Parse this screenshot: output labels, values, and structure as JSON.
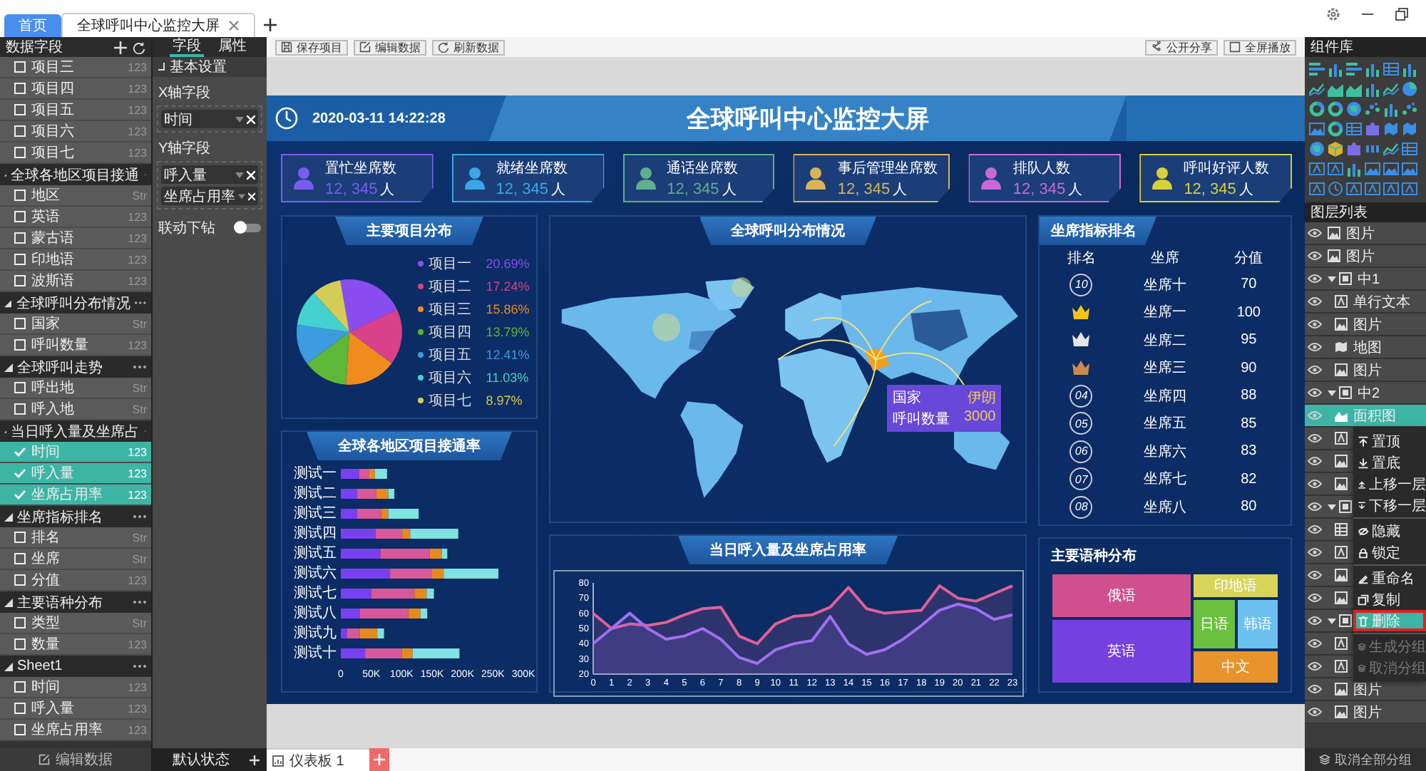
{
  "top_tabs": [
    {
      "label": "首页",
      "selected": false
    },
    {
      "label": "全球呼叫中心监控大屏",
      "selected": true
    }
  ],
  "fields_panel": {
    "title": "数据字段",
    "footer": "编辑数据",
    "groups": [
      {
        "fields": [
          {
            "label": "项目三",
            "type": "123",
            "checked": false
          },
          {
            "label": "项目四",
            "type": "123",
            "checked": false
          },
          {
            "label": "项目五",
            "type": "123",
            "checked": false
          },
          {
            "label": "项目六",
            "type": "123",
            "checked": false
          },
          {
            "label": "项目七",
            "type": "123",
            "checked": false
          }
        ]
      },
      {
        "name": "全球各地区项目接通",
        "fields": [
          {
            "label": "地区",
            "type": "Str",
            "checked": false
          },
          {
            "label": "英语",
            "type": "123",
            "checked": false
          },
          {
            "label": "蒙古语",
            "type": "123",
            "checked": false
          },
          {
            "label": "印地语",
            "type": "123",
            "checked": false
          },
          {
            "label": "波斯语",
            "type": "123",
            "checked": false
          }
        ]
      },
      {
        "name": "全球呼叫分布情况",
        "fields": [
          {
            "label": "国家",
            "type": "Str",
            "checked": false
          },
          {
            "label": "呼叫数量",
            "type": "123",
            "checked": false
          }
        ]
      },
      {
        "name": "全球呼叫走势",
        "fields": [
          {
            "label": "呼出地",
            "type": "Str",
            "checked": false
          },
          {
            "label": "呼入地",
            "type": "Str",
            "checked": false
          }
        ]
      },
      {
        "name": "当日呼入量及坐席占",
        "fields": [
          {
            "label": "时间",
            "type": "123",
            "checked": true
          },
          {
            "label": "呼入量",
            "type": "123",
            "checked": true
          },
          {
            "label": "坐席占用率",
            "type": "123",
            "checked": true
          }
        ]
      },
      {
        "name": "坐席指标排名",
        "fields": [
          {
            "label": "排名",
            "type": "Str",
            "checked": false
          },
          {
            "label": "坐席",
            "type": "Str",
            "checked": false
          },
          {
            "label": "分值",
            "type": "123",
            "checked": false
          }
        ]
      },
      {
        "name": "主要语种分布",
        "fields": [
          {
            "label": "类型",
            "type": "Str",
            "checked": false
          },
          {
            "label": "数量",
            "type": "123",
            "checked": false
          }
        ]
      },
      {
        "name": "Sheet1",
        "fields": [
          {
            "label": "时间",
            "type": "123",
            "checked": false
          },
          {
            "label": "呼入量",
            "type": "123",
            "checked": false
          },
          {
            "label": "坐席占用率",
            "type": "123",
            "checked": false
          }
        ]
      }
    ]
  },
  "settings": {
    "tabs": [
      {
        "label": "字段",
        "selected": true
      },
      {
        "label": "属性",
        "selected": false
      }
    ],
    "section": "基本设置",
    "x_axis": {
      "label": "X轴字段",
      "fields": [
        "时间"
      ]
    },
    "y_axis": {
      "label": "Y轴字段",
      "fields": [
        "呼入量",
        "坐席占用率"
      ]
    },
    "drilldown": {
      "label": "联动下钻",
      "on": false
    },
    "footer": "默认状态"
  },
  "toolbar": {
    "left": [
      {
        "label": "保存项目",
        "kind": "save"
      },
      {
        "label": "编辑数据",
        "kind": "edit"
      },
      {
        "label": "刷新数据",
        "kind": "refresh"
      }
    ],
    "right": [
      {
        "label": "公开分享",
        "kind": "share"
      },
      {
        "label": "全屏播放",
        "kind": "fullscreen"
      }
    ]
  },
  "dashboard": {
    "datetime": "2020-03-11 14:22:28",
    "title": "全球呼叫中心监控大屏",
    "kpis": [
      {
        "label": "置忙坐席数",
        "value": "12, 345",
        "unit": "人",
        "color": "#7b5cf0"
      },
      {
        "label": "就绪坐席数",
        "value": "12, 345",
        "unit": "人",
        "color": "#3aa6e8"
      },
      {
        "label": "通话坐席数",
        "value": "12, 345",
        "unit": "人",
        "color": "#5fae8e"
      },
      {
        "label": "事后管理坐席数",
        "value": "12, 345",
        "unit": "人",
        "color": "#d8b45a"
      },
      {
        "label": "排队人数",
        "value": "12, 345",
        "unit": "人",
        "color": "#c86ad6"
      },
      {
        "label": "呼叫好评人数",
        "value": "12, 345",
        "unit": "人",
        "color": "#d6d13a"
      }
    ],
    "pie": {
      "title": "主要项目分布",
      "legend": [
        {
          "value": "20.69%",
          "color": "#8a4df0"
        },
        {
          "value": "17.24%",
          "color": "#d9418a"
        },
        {
          "value": "15.86%",
          "color": "#f08c1e"
        },
        {
          "value": "13.79%",
          "color": "#5cb836"
        },
        {
          "value": "12.41%",
          "color": "#3d9be0"
        },
        {
          "value": "11.03%",
          "color": "#45d1cf"
        },
        {
          "value": "8.97%",
          "color": "#d4cc55"
        }
      ],
      "chart_data": {
        "type": "pie",
        "categories": [
          "项目一",
          "项目二",
          "项目三",
          "项目四",
          "项目五",
          "项目六",
          "项目七"
        ],
        "values": [
          20.69,
          17.24,
          15.86,
          13.79,
          12.41,
          11.03,
          8.97
        ]
      }
    },
    "map": {
      "title": "全球呼叫分布情况",
      "tooltip": [
        {
          "label": "国家",
          "value": "伊朗"
        },
        {
          "label": "呼叫数量",
          "value": "3000"
        }
      ]
    },
    "ranking": {
      "title": "坐席指标排名",
      "columns": [
        "排名",
        "坐席",
        "分值"
      ],
      "rows": [
        {
          "kind": "badge",
          "rank": "10",
          "seat": "坐席十",
          "score": "70"
        },
        {
          "kind": "medal",
          "color": "#f5c31c",
          "seat": "坐席一",
          "score": "100"
        },
        {
          "kind": "medal",
          "color": "#e6e6e6",
          "seat": "坐席二",
          "score": "95"
        },
        {
          "kind": "medal",
          "color": "#c98a4e",
          "seat": "坐席三",
          "score": "90"
        },
        {
          "kind": "badge",
          "rank": "04",
          "seat": "坐席四",
          "score": "88"
        },
        {
          "kind": "badge",
          "rank": "05",
          "seat": "坐席五",
          "score": "85"
        },
        {
          "kind": "badge",
          "rank": "06",
          "seat": "坐席六",
          "score": "83"
        },
        {
          "kind": "badge",
          "rank": "07",
          "seat": "坐席七",
          "score": "82"
        },
        {
          "kind": "badge",
          "rank": "08",
          "seat": "坐席八",
          "score": "80"
        }
      ]
    },
    "bars": {
      "title": "全球各地区项目接通率",
      "chart_data": {
        "type": "bar",
        "orientation": "horizontal",
        "stacked": true,
        "categories": [
          "测试一",
          "测试二",
          "测试三",
          "测试四",
          "测试五",
          "测试六",
          "测试七",
          "测试八",
          "测试九",
          "测试十"
        ],
        "series": [
          {
            "color": "#7b3ff2",
            "values": [
              30,
              27,
              27,
              57,
              65,
              81,
              50,
              31,
              10,
              40
            ]
          },
          {
            "color": "#d9589a",
            "values": [
              16,
              31,
              39,
              44,
              81,
              69,
              71,
              80,
              21,
              60
            ]
          },
          {
            "color": "#e8891e",
            "values": [
              10,
              20,
              12,
              13,
              20,
              19,
              20,
              20,
              29,
              18
            ]
          },
          {
            "color": "#7fe3e0",
            "values": [
              20,
              10,
              50,
              79,
              9,
              90,
              12,
              11,
              11,
              77
            ]
          }
        ],
        "xlim": [
          0,
          300
        ],
        "xticks": [
          {
            "value": 0,
            "label": "0"
          },
          {
            "value": 50,
            "label": "50K"
          },
          {
            "value": 100,
            "label": "100K"
          },
          {
            "value": 150,
            "label": "150K"
          },
          {
            "value": 200,
            "label": "200K"
          },
          {
            "value": 250,
            "label": "250K"
          },
          {
            "value": 300,
            "label": "300K"
          }
        ]
      }
    },
    "line": {
      "title": "当日呼入量及坐席占用率",
      "chart_data": {
        "type": "area",
        "x": [
          0,
          1,
          2,
          3,
          4,
          5,
          6,
          7,
          8,
          9,
          10,
          11,
          12,
          13,
          14,
          15,
          16,
          17,
          18,
          19,
          20,
          21,
          22,
          23
        ],
        "series": [
          {
            "color": "#e0609a",
            "values": [
              60,
              50,
              53,
              52,
              54,
              59,
              63,
              64,
              45,
              40,
              53,
              58,
              59,
              64,
              77,
              63,
              60,
              61,
              62,
              78,
              70,
              68,
              73,
              78
            ]
          },
          {
            "color": "#a070f0",
            "values": [
              40,
              50,
              60,
              50,
              43,
              45,
              50,
              43,
              31,
              27,
              36,
              40,
              42,
              58,
              40,
              33,
              36,
              43,
              52,
              62,
              66,
              63,
              56,
              59
            ]
          }
        ],
        "xlim": [
          0,
          23
        ],
        "ylim": [
          20,
          80
        ],
        "yticks": [
          20,
          30,
          40,
          50,
          60,
          70,
          80
        ],
        "xticks": [
          0,
          1,
          2,
          3,
          4,
          5,
          6,
          7,
          8,
          9,
          10,
          11,
          12,
          13,
          14,
          15,
          16,
          17,
          18,
          19,
          20,
          21,
          22,
          23
        ]
      }
    },
    "languages": {
      "title": "主要语种分布",
      "items": [
        {
          "label": "俄语",
          "color": "#d0508f"
        },
        {
          "label": "英语",
          "color": "#7640e0"
        },
        {
          "label": "印地语",
          "color": "#d8d45a"
        },
        {
          "label": "日语",
          "color": "#6cc040"
        },
        {
          "label": "韩语",
          "color": "#6cc0f0"
        },
        {
          "label": "中文",
          "color": "#e8942a"
        }
      ]
    }
  },
  "sheet_tabs": [
    {
      "label": "仪表板 1",
      "selected": true
    }
  ],
  "right_panel": {
    "library_title": "组件库",
    "layers_title": "图层列表",
    "footer": "取消全部分组",
    "layers": [
      {
        "label": "图片",
        "kind": "image",
        "selected": false
      },
      {
        "label": "图片",
        "kind": "image",
        "selected": false
      },
      {
        "label": "中1",
        "kind": "group",
        "expanded": true,
        "selected": false,
        "children": [
          {
            "label": "单行文本",
            "kind": "text",
            "selected": false
          },
          {
            "label": "图片",
            "kind": "image",
            "selected": false
          },
          {
            "label": "地图",
            "kind": "map",
            "selected": false
          },
          {
            "label": "图片",
            "kind": "image",
            "selected": false
          }
        ]
      },
      {
        "label": "中2",
        "kind": "group",
        "expanded": true,
        "selected": false,
        "children": [
          {
            "label": "面积图",
            "kind": "area",
            "selected": true
          },
          {
            "kind": "text",
            "selected": false
          },
          {
            "kind": "image",
            "selected": false
          },
          {
            "kind": "image",
            "selected": false
          }
        ]
      },
      {
        "kind": "group",
        "expanded": true,
        "selected": false,
        "children": [
          {
            "kind": "table",
            "selected": false
          },
          {
            "kind": "text",
            "selected": false
          },
          {
            "kind": "image",
            "selected": false
          },
          {
            "kind": "image",
            "selected": false
          }
        ]
      },
      {
        "kind": "group",
        "expanded": true,
        "selected": false,
        "children": [
          {
            "kind": "text",
            "selected": false
          },
          {
            "kind": "text",
            "selected": false
          },
          {
            "label": "图片",
            "kind": "image",
            "selected": false
          },
          {
            "label": "图片",
            "kind": "image",
            "selected": false
          }
        ]
      }
    ],
    "context_menu": [
      {
        "items": [
          {
            "label": "置顶",
            "kind": "top",
            "disabled": false,
            "highlighted": false
          },
          {
            "label": "置底",
            "kind": "bottom",
            "disabled": false,
            "highlighted": false
          },
          {
            "label": "上移一层",
            "kind": "up",
            "disabled": false,
            "highlighted": false
          },
          {
            "label": "下移一层",
            "kind": "down",
            "disabled": false,
            "highlighted": false
          }
        ]
      },
      {
        "items": [
          {
            "label": "隐藏",
            "kind": "hide",
            "disabled": false,
            "highlighted": false
          },
          {
            "label": "锁定",
            "kind": "lock",
            "disabled": false,
            "highlighted": false
          }
        ]
      },
      {
        "items": [
          {
            "label": "重命名",
            "kind": "rename",
            "disabled": false,
            "highlighted": false
          },
          {
            "label": "复制",
            "kind": "copy",
            "disabled": false,
            "highlighted": false
          },
          {
            "label": "删除",
            "kind": "delete",
            "disabled": false,
            "highlighted": true
          }
        ]
      },
      {
        "items": [
          {
            "label": "生成分组",
            "kind": "group",
            "disabled": true,
            "highlighted": false
          },
          {
            "label": "取消分组",
            "kind": "group",
            "disabled": true,
            "highlighted": false
          }
        ]
      }
    ]
  }
}
